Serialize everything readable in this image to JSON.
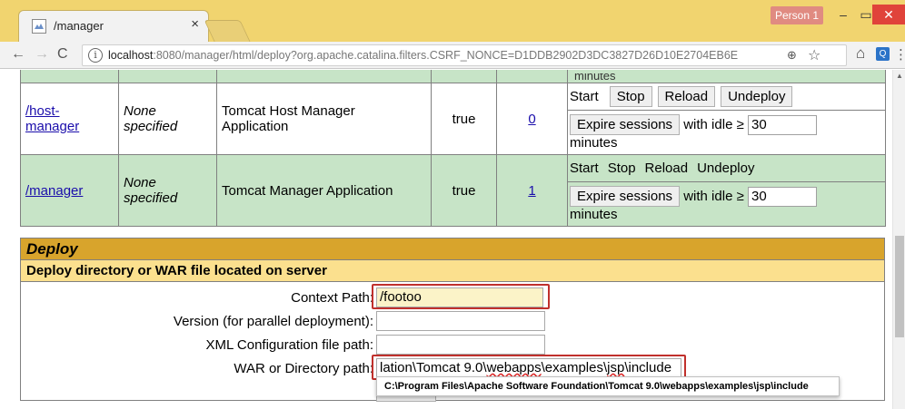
{
  "browser": {
    "tab_title": "/manager",
    "tab_close": "×",
    "profile": "Person 1",
    "window_min": "–",
    "window_max": "▭",
    "window_close": "✕",
    "nav_back": "←",
    "nav_forward": "→",
    "nav_reload": "C",
    "url_host": "localhost",
    "url_rest": ":8080/manager/html/deploy?org.apache.catalina.filters.CSRF_NONCE=D1DDB2902D3DC3827D26D10E2704EB6E",
    "icons": {
      "info": "i",
      "zoom": "⊕",
      "star": "☆",
      "home": "⌂",
      "extension": "Q",
      "menu": "⋮"
    }
  },
  "apps_table": {
    "top_row": {
      "minutes": "minutes"
    },
    "rows": [
      {
        "path_line1": "/host-",
        "path_line2": "manager",
        "version_line1": "None",
        "version_line2": "specified",
        "display_line1": "Tomcat Host Manager",
        "display_line2": "Application",
        "running": "true",
        "sessions": "0",
        "cmd_start": "Start",
        "cmd_stop": "Stop",
        "cmd_reload": "Reload",
        "cmd_undeploy": "Undeploy",
        "expire_label": "Expire sessions",
        "idle_label": "with idle ≥",
        "idle_value": "30",
        "minutes": "minutes"
      },
      {
        "path_line1": "/manager",
        "version_line1": "None",
        "version_line2": "specified",
        "display_line1": "Tomcat Manager Application",
        "running": "true",
        "sessions": "1",
        "cmd_start": "Start",
        "cmd_stop": "Stop",
        "cmd_reload": "Reload",
        "cmd_undeploy": "Undeploy",
        "expire_label": "Expire sessions",
        "idle_label": "with idle ≥",
        "idle_value": "30",
        "minutes": "minutes"
      }
    ]
  },
  "deploy": {
    "title": "Deploy",
    "subtitle": "Deploy directory or WAR file located on server",
    "context_label": "Context Path:",
    "context_value": "/footoo",
    "version_label": "Version (for parallel deployment):",
    "version_value": "",
    "xml_label": "XML Configuration file path:",
    "xml_value": "",
    "war_label": "WAR or Directory path:",
    "war_value_a": "lation\\Tomcat 9.0\\",
    "war_value_b": "webapps",
    "war_value_c": "\\examples\\",
    "war_value_d": "jsp",
    "war_value_e": "\\include",
    "autocomplete": "C:\\Program Files\\Apache Software Foundation\\Tomcat 9.0\\webapps\\examples\\jsp\\include"
  },
  "colors": {
    "chrome_title": "#f1d46f",
    "green_row": "#c7e4c7",
    "deploy_header": "#d8a42c",
    "deploy_sub": "#fbe08e",
    "highlight_red": "#c0302c"
  }
}
